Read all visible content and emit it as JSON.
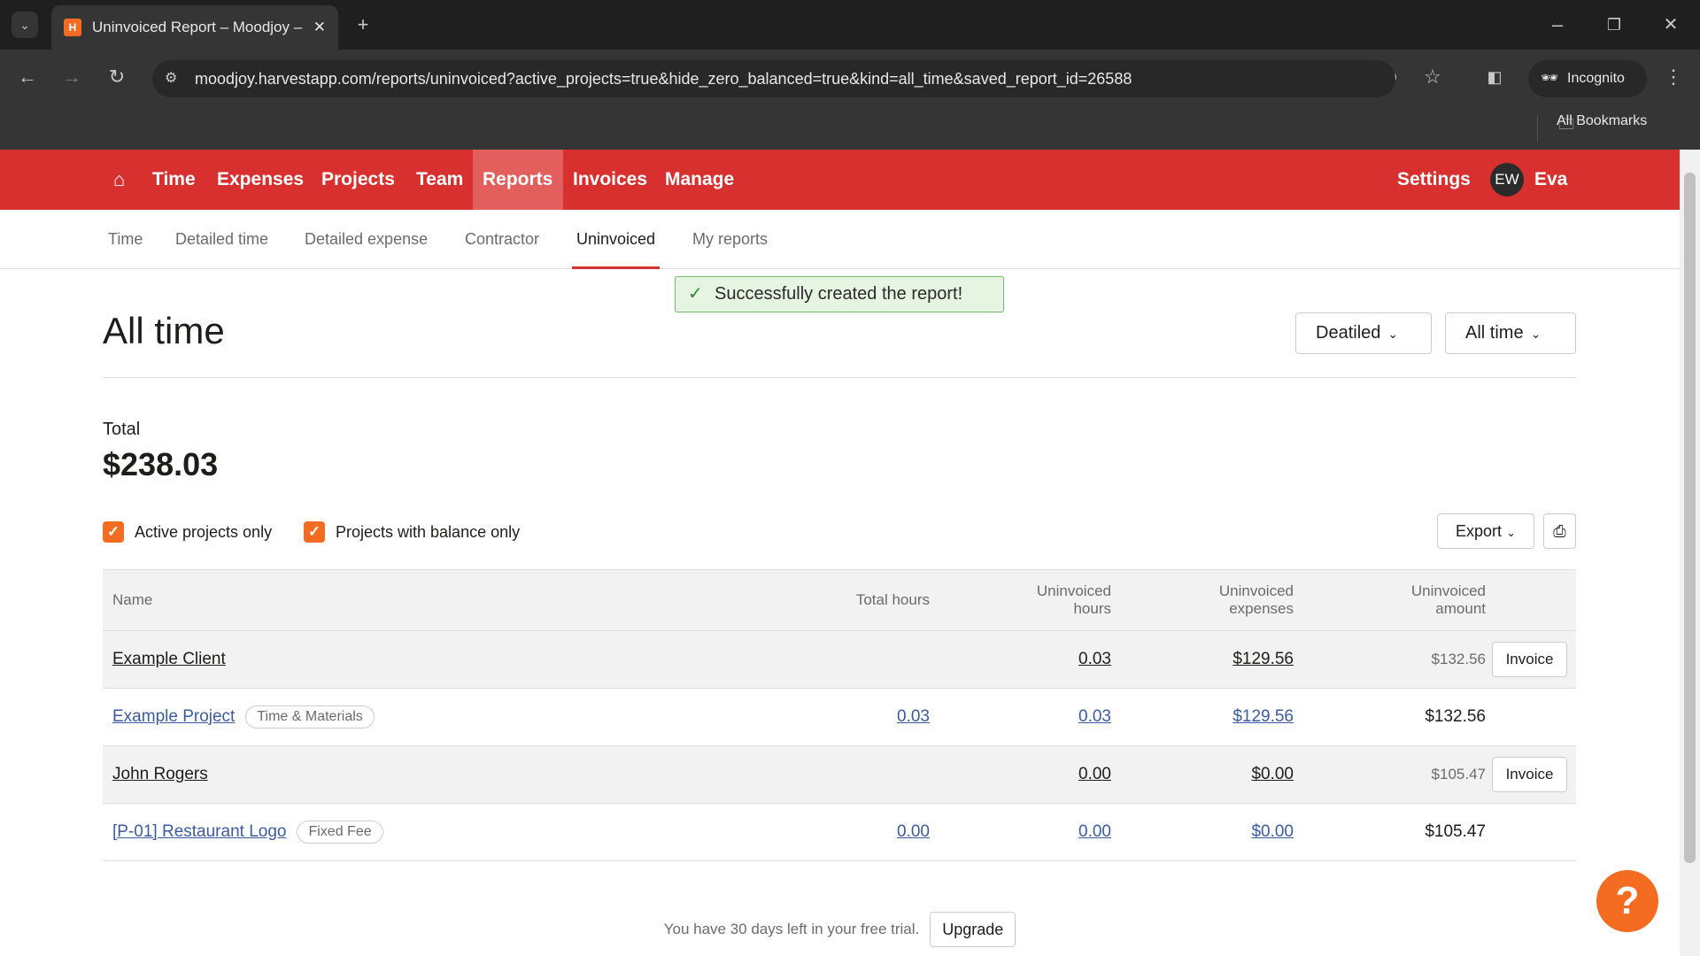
{
  "browser": {
    "tab_title": "Uninvoiced Report – Moodjoy – Harvest",
    "url": "moodjoy.harvestapp.com/reports/uninvoiced?active_projects=true&hide_zero_balanced=true&kind=all_time&saved_report_id=26588",
    "incognito": "Incognito",
    "bookmarks": "All Bookmarks"
  },
  "nav": {
    "items": [
      "Time",
      "Expenses",
      "Projects",
      "Team",
      "Reports",
      "Invoices",
      "Manage"
    ],
    "active": "Reports",
    "settings": "Settings",
    "avatar_initials": "EW",
    "user": "Eva",
    "color": "#d8302f"
  },
  "subnav": {
    "items": [
      "Time",
      "Detailed time",
      "Detailed expense",
      "Contractor",
      "Uninvoiced",
      "My reports"
    ],
    "active": "Uninvoiced"
  },
  "toast": "Successfully created the report!",
  "page": {
    "title": "All time",
    "view_dropdown": "Deatiled",
    "period_dropdown": "All time",
    "total_label": "Total",
    "total_value": "$238.03",
    "filters": [
      {
        "label": "Active projects only",
        "checked": true
      },
      {
        "label": "Projects with balance only",
        "checked": true
      }
    ],
    "export": "Export"
  },
  "table": {
    "headers": [
      "Name",
      "Total hours",
      "Uninvoiced hours",
      "Uninvoiced expenses",
      "Uninvoiced amount"
    ],
    "headers_split": [
      [
        "Name"
      ],
      [
        "Total hours"
      ],
      [
        "Uninvoiced",
        "hours"
      ],
      [
        "Uninvoiced",
        "expenses"
      ],
      [
        "Uninvoiced",
        "amount"
      ]
    ],
    "rows": [
      {
        "type": "client",
        "name": "Example Client",
        "total_hours": "",
        "uninvoiced_hours": "0.03",
        "uninvoiced_expenses": "$129.56",
        "uninvoiced_amount": "$132.56",
        "action": "Invoice"
      },
      {
        "type": "project",
        "name": "Example Project",
        "badge": "Time & Materials",
        "total_hours": "0.03",
        "uninvoiced_hours": "0.03",
        "uninvoiced_expenses": "$129.56",
        "uninvoiced_amount": "$132.56"
      },
      {
        "type": "client",
        "name": "John Rogers",
        "total_hours": "",
        "uninvoiced_hours": "0.00",
        "uninvoiced_expenses": "$0.00",
        "uninvoiced_amount": "$105.47",
        "action": "Invoice"
      },
      {
        "type": "project",
        "name": "[P-01] Restaurant Logo",
        "badge": "Fixed Fee",
        "total_hours": "0.00",
        "uninvoiced_hours": "0.00",
        "uninvoiced_expenses": "$0.00",
        "uninvoiced_amount": "$105.47"
      }
    ]
  },
  "footer": {
    "trial_text": "You have 30 days left in your free trial.",
    "upgrade": "Upgrade"
  },
  "help": "?"
}
